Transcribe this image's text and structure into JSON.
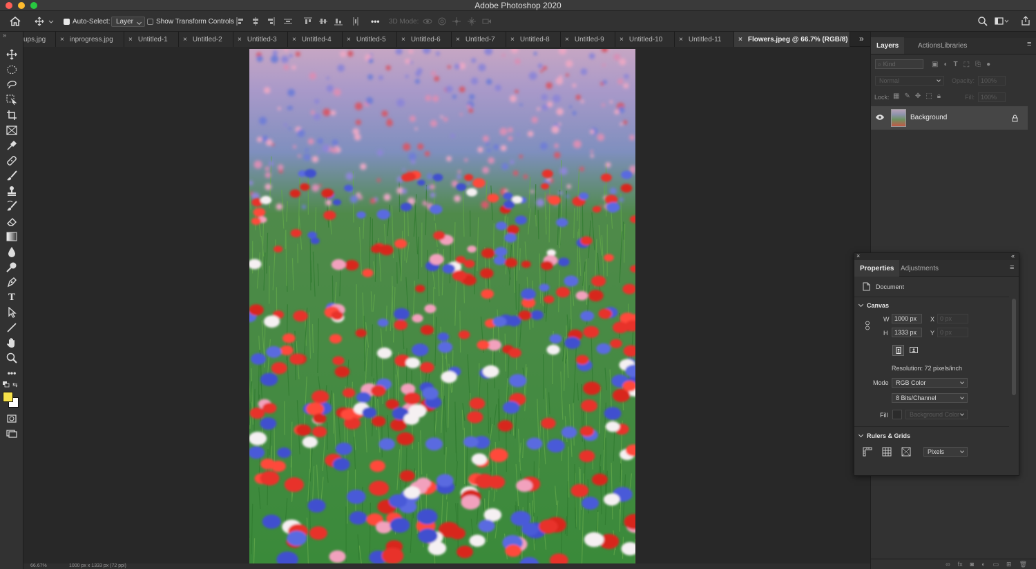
{
  "app": {
    "title": "Adobe Photoshop 2020"
  },
  "window_controls": {
    "close_color": "#fe5f57",
    "minimize_color": "#febc2e",
    "maximize_color": "#28c840"
  },
  "options_bar": {
    "auto_select_label": "Auto-Select:",
    "auto_select_checked": true,
    "auto_select_target": "Layer",
    "show_transform_label": "Show Transform Controls",
    "show_transform_checked": false,
    "mode_3d_label": "3D Mode:",
    "more_label": "•••"
  },
  "tabs": [
    {
      "label": "ups.jpg",
      "active": false
    },
    {
      "label": "inprogress.jpg",
      "active": false
    },
    {
      "label": "Untitled-1",
      "active": false
    },
    {
      "label": "Untitled-2",
      "active": false
    },
    {
      "label": "Untitled-3",
      "active": false
    },
    {
      "label": "Untitled-4",
      "active": false
    },
    {
      "label": "Untitled-5",
      "active": false
    },
    {
      "label": "Untitled-6",
      "active": false
    },
    {
      "label": "Untitled-7",
      "active": false
    },
    {
      "label": "Untitled-8",
      "active": false
    },
    {
      "label": "Untitled-9",
      "active": false
    },
    {
      "label": "Untitled-10",
      "active": false
    },
    {
      "label": "Untitled-11",
      "active": false
    },
    {
      "label": "Flowers.jpeg @ 66.7% (RGB/8)",
      "active": true
    }
  ],
  "tab_close_glyph": "×",
  "tab_overflow_glyph": "»",
  "colors": {
    "foreground": "#f5e04a",
    "background": "#ffffff",
    "ui_dark": "#323232"
  },
  "layers_panel": {
    "tabs": [
      "Layers",
      "Actions",
      "Libraries"
    ],
    "filter_placeholder": "Kind",
    "blend_mode": "Normal",
    "opacity_label": "Opacity:",
    "opacity_value": "100%",
    "lock_label": "Lock:",
    "fill_label": "Fill:",
    "fill_value": "100%",
    "layers": [
      {
        "name": "Background",
        "visible": true,
        "locked": true
      }
    ]
  },
  "properties_panel": {
    "tabs": [
      "Properties",
      "Adjustments"
    ],
    "document_label": "Document",
    "canvas_section": "Canvas",
    "w_label": "W",
    "w_value": "1000 px",
    "h_label": "H",
    "h_value": "1333 px",
    "x_label": "X",
    "x_placeholder": "0 px",
    "y_label": "Y",
    "y_placeholder": "0 px",
    "resolution": "Resolution: 72 pixels/inch",
    "mode_label": "Mode",
    "mode_value": "RGB Color",
    "depth_value": "8 Bits/Channel",
    "fill_label": "Fill",
    "fill_value": "Background Color",
    "rulers_section": "Rulers & Grids",
    "units_value": "Pixels"
  },
  "status_bar": {
    "zoom": "66.67%",
    "doc_info": "1000 px x 1333 px (72 ppi)"
  }
}
